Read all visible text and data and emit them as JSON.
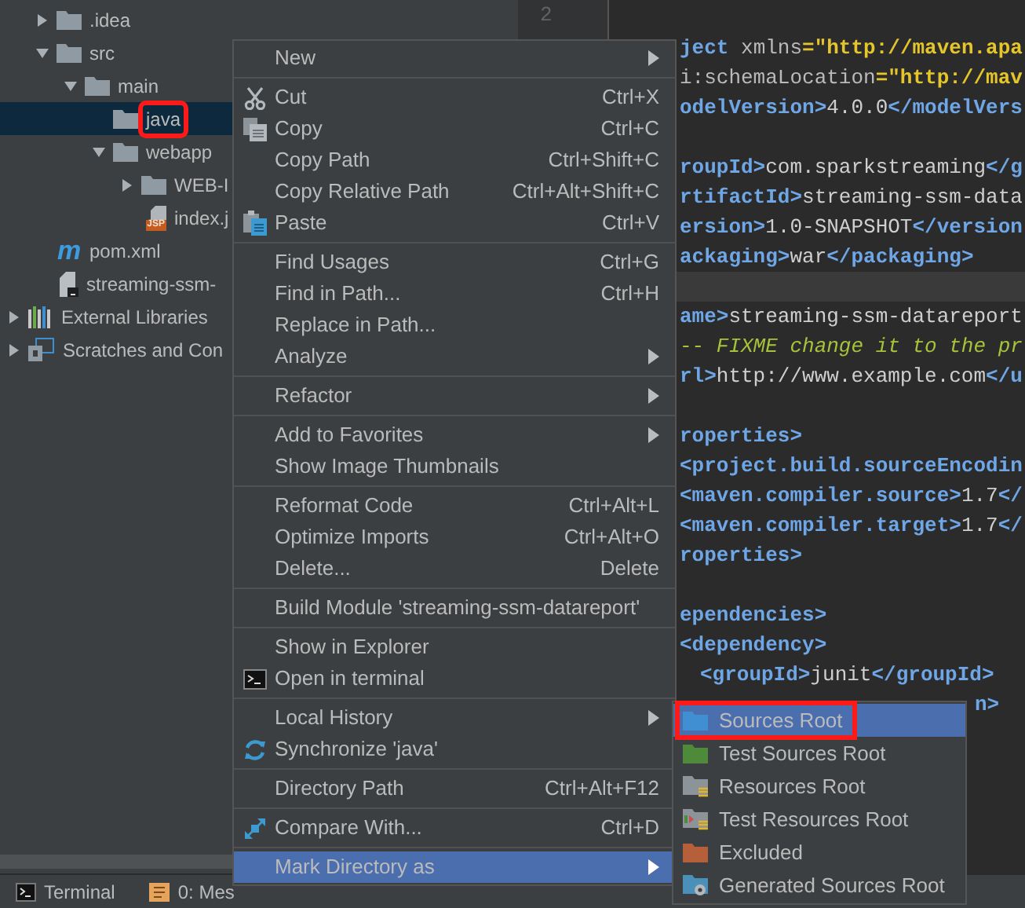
{
  "project_tree": {
    "module_contents": [
      {
        "kind": "folder",
        "label": ".idea",
        "expanded": false,
        "selected": false,
        "annotated": false
      },
      {
        "kind": "folder",
        "label": "src",
        "expanded": true,
        "selected": false,
        "annotated": false,
        "children": [
          {
            "kind": "folder",
            "label": "main",
            "expanded": true,
            "selected": false,
            "annotated": false,
            "children": [
              {
                "kind": "folder",
                "label": "java",
                "selected": true,
                "annotated": true
              },
              {
                "kind": "folder",
                "label": "webapp",
                "expanded": true,
                "selected": false,
                "annotated": false,
                "children": [
                  {
                    "kind": "folder",
                    "label": "WEB-I",
                    "expanded": false,
                    "selected": false,
                    "annotated": false
                  },
                  {
                    "kind": "jsp",
                    "label": "index.j",
                    "badge": "JSP",
                    "selected": false,
                    "annotated": false
                  }
                ]
              }
            ]
          }
        ]
      },
      {
        "kind": "maven",
        "label": "pom.xml",
        "badge": "m",
        "selected": false,
        "annotated": false
      },
      {
        "kind": "file",
        "label": "streaming-ssm-",
        "selected": false,
        "annotated": false
      }
    ],
    "root_items": [
      {
        "kind": "libraries",
        "label": "External Libraries",
        "expanded": false,
        "selected": false,
        "annotated": false
      },
      {
        "kind": "scratches",
        "label": "Scratches and Con",
        "expanded": false,
        "selected": false,
        "annotated": false
      }
    ]
  },
  "editor": {
    "line_number": "2",
    "lines": [
      {
        "kind": "code",
        "current": false,
        "tokens": [
          {
            "kind": "tag",
            "text": "ject"
          },
          {
            "kind": "attr",
            "text": " xmlns"
          },
          {
            "kind": "value",
            "text": "=\"http://maven.apa"
          }
        ]
      },
      {
        "kind": "code",
        "current": false,
        "tokens": [
          {
            "kind": "attr",
            "text": "i:schemaLocation"
          },
          {
            "kind": "value",
            "text": "=\"http://mav"
          }
        ]
      },
      {
        "kind": "code",
        "current": false,
        "tokens": [
          {
            "kind": "tag",
            "text": "odelVersion>"
          },
          {
            "kind": "text",
            "text": "4.0.0"
          },
          {
            "kind": "tag",
            "text": "</modelVers"
          }
        ]
      },
      {
        "kind": "blank",
        "current": false
      },
      {
        "kind": "code",
        "current": false,
        "tokens": [
          {
            "kind": "tag",
            "text": "roupId>"
          },
          {
            "kind": "text",
            "text": "com.sparkstreaming"
          },
          {
            "kind": "tag",
            "text": "</g"
          }
        ]
      },
      {
        "kind": "code",
        "current": false,
        "tokens": [
          {
            "kind": "tag",
            "text": "rtifactId>"
          },
          {
            "kind": "text",
            "text": "streaming-ssm-data"
          }
        ]
      },
      {
        "kind": "code",
        "current": false,
        "tokens": [
          {
            "kind": "tag",
            "text": "ersion>"
          },
          {
            "kind": "text",
            "text": "1.0-SNAPSHOT"
          },
          {
            "kind": "tag",
            "text": "</version"
          }
        ]
      },
      {
        "kind": "code",
        "current": false,
        "tokens": [
          {
            "kind": "tag",
            "text": "ackaging>"
          },
          {
            "kind": "text",
            "text": "war"
          },
          {
            "kind": "tag",
            "text": "</packaging>"
          }
        ]
      },
      {
        "kind": "blank",
        "current": true
      },
      {
        "kind": "code",
        "current": false,
        "tokens": [
          {
            "kind": "tag",
            "text": "ame>"
          },
          {
            "kind": "text",
            "text": "streaming-ssm-datareport"
          }
        ]
      },
      {
        "kind": "code",
        "current": false,
        "tokens": [
          {
            "kind": "comment",
            "text": "-- FIXME change it to the pr"
          }
        ]
      },
      {
        "kind": "code",
        "current": false,
        "tokens": [
          {
            "kind": "tag",
            "text": "rl>"
          },
          {
            "kind": "text",
            "text": "http://www.example.com"
          },
          {
            "kind": "tag",
            "text": "</u"
          }
        ]
      },
      {
        "kind": "blank",
        "current": false
      },
      {
        "kind": "code",
        "current": false,
        "tokens": [
          {
            "kind": "tag",
            "text": "roperties>"
          }
        ]
      },
      {
        "kind": "code",
        "current": false,
        "tokens": [
          {
            "kind": "tag",
            "text": "<project.build.sourceEncodin"
          }
        ]
      },
      {
        "kind": "code",
        "current": false,
        "tokens": [
          {
            "kind": "tag",
            "text": "<maven.compiler.source>"
          },
          {
            "kind": "text",
            "text": "1.7"
          },
          {
            "kind": "tag",
            "text": "</"
          }
        ]
      },
      {
        "kind": "code",
        "current": false,
        "tokens": [
          {
            "kind": "tag",
            "text": "<maven.compiler.target>"
          },
          {
            "kind": "text",
            "text": "1.7"
          },
          {
            "kind": "tag",
            "text": "</"
          }
        ]
      },
      {
        "kind": "code",
        "current": false,
        "tokens": [
          {
            "kind": "tag",
            "text": "roperties>"
          }
        ]
      },
      {
        "kind": "blank",
        "current": false
      },
      {
        "kind": "code",
        "current": false,
        "tokens": [
          {
            "kind": "tag",
            "text": "ependencies>"
          }
        ]
      },
      {
        "kind": "code",
        "current": false,
        "tokens": [
          {
            "kind": "tag",
            "text": "<dependency>"
          }
        ]
      },
      {
        "kind": "indented",
        "current": false,
        "tokens": [
          {
            "kind": "tag",
            "text": "<groupId>"
          },
          {
            "kind": "text",
            "text": "junit"
          },
          {
            "kind": "tag",
            "text": "</groupId>"
          }
        ]
      },
      {
        "kind": "tail",
        "current": false,
        "tokens": [
          {
            "kind": "tag",
            "text": "n>"
          }
        ]
      }
    ]
  },
  "context_menu": [
    {
      "kind": "item",
      "label": "New",
      "submenu": true,
      "selected": false
    },
    {
      "kind": "separator"
    },
    {
      "kind": "cut",
      "label": "Cut",
      "shortcut": "Ctrl+X",
      "submenu": false,
      "selected": false
    },
    {
      "kind": "copy",
      "label": "Copy",
      "shortcut": "Ctrl+C",
      "submenu": false,
      "selected": false
    },
    {
      "kind": "item",
      "label": "Copy Path",
      "shortcut": "Ctrl+Shift+C",
      "submenu": false,
      "selected": false
    },
    {
      "kind": "item",
      "label": "Copy Relative Path",
      "shortcut": "Ctrl+Alt+Shift+C",
      "submenu": false,
      "selected": false
    },
    {
      "kind": "paste",
      "label": "Paste",
      "shortcut": "Ctrl+V",
      "submenu": false,
      "selected": false
    },
    {
      "kind": "separator"
    },
    {
      "kind": "item",
      "label": "Find Usages",
      "shortcut": "Ctrl+G",
      "submenu": false,
      "selected": false
    },
    {
      "kind": "item",
      "label": "Find in Path...",
      "shortcut": "Ctrl+H",
      "submenu": false,
      "selected": false
    },
    {
      "kind": "item",
      "label": "Replace in Path...",
      "submenu": false,
      "selected": false
    },
    {
      "kind": "item",
      "label": "Analyze",
      "submenu": true,
      "selected": false
    },
    {
      "kind": "separator"
    },
    {
      "kind": "item",
      "label": "Refactor",
      "submenu": true,
      "selected": false
    },
    {
      "kind": "separator"
    },
    {
      "kind": "item",
      "label": "Add to Favorites",
      "submenu": true,
      "selected": false
    },
    {
      "kind": "item",
      "label": "Show Image Thumbnails",
      "submenu": false,
      "selected": false
    },
    {
      "kind": "separator"
    },
    {
      "kind": "item",
      "label": "Reformat Code",
      "shortcut": "Ctrl+Alt+L",
      "submenu": false,
      "selected": false
    },
    {
      "kind": "item",
      "label": "Optimize Imports",
      "shortcut": "Ctrl+Alt+O",
      "submenu": false,
      "selected": false
    },
    {
      "kind": "item",
      "label": "Delete...",
      "shortcut": "Delete",
      "submenu": false,
      "selected": false
    },
    {
      "kind": "separator"
    },
    {
      "kind": "item",
      "label": "Build Module 'streaming-ssm-datareport'",
      "submenu": false,
      "selected": false
    },
    {
      "kind": "separator"
    },
    {
      "kind": "item",
      "label": "Show in Explorer",
      "submenu": false,
      "selected": false
    },
    {
      "kind": "terminal",
      "label": "Open in terminal",
      "submenu": false,
      "selected": false
    },
    {
      "kind": "separator"
    },
    {
      "kind": "item",
      "label": "Local History",
      "submenu": true,
      "selected": false
    },
    {
      "kind": "sync",
      "label": "Synchronize 'java'",
      "submenu": false,
      "selected": false
    },
    {
      "kind": "separator"
    },
    {
      "kind": "item",
      "label": "Directory Path",
      "shortcut": "Ctrl+Alt+F12",
      "submenu": false,
      "selected": false
    },
    {
      "kind": "separator"
    },
    {
      "kind": "compare",
      "label": "Compare With...",
      "shortcut": "Ctrl+D",
      "submenu": false,
      "selected": false
    },
    {
      "kind": "separator"
    },
    {
      "kind": "item",
      "label": "Mark Directory as",
      "submenu": true,
      "selected": true
    }
  ],
  "mark_directory_submenu": [
    {
      "kind": "folder",
      "label": "Sources Root",
      "color": "#3f8fd2",
      "selected": true,
      "annotated": true
    },
    {
      "kind": "folder",
      "label": "Test Sources Root",
      "color": "#4f8a3a",
      "selected": false,
      "annotated": false
    },
    {
      "kind": "resources",
      "label": "Resources Root",
      "color": "#8c9399",
      "selected": false,
      "annotated": false
    },
    {
      "kind": "test_resources",
      "label": "Test Resources Root",
      "color": "#8c9399",
      "selected": false,
      "annotated": false
    },
    {
      "kind": "folder",
      "label": "Excluded",
      "color": "#b5603a",
      "selected": false,
      "annotated": false
    },
    {
      "kind": "generated",
      "label": "Generated Sources Root",
      "color": "#4a90b8",
      "selected": false,
      "annotated": false
    }
  ],
  "tool_window_bar": [
    {
      "kind": "terminal",
      "label": "Terminal"
    },
    {
      "kind": "messages",
      "label": "0: Mes"
    }
  ]
}
